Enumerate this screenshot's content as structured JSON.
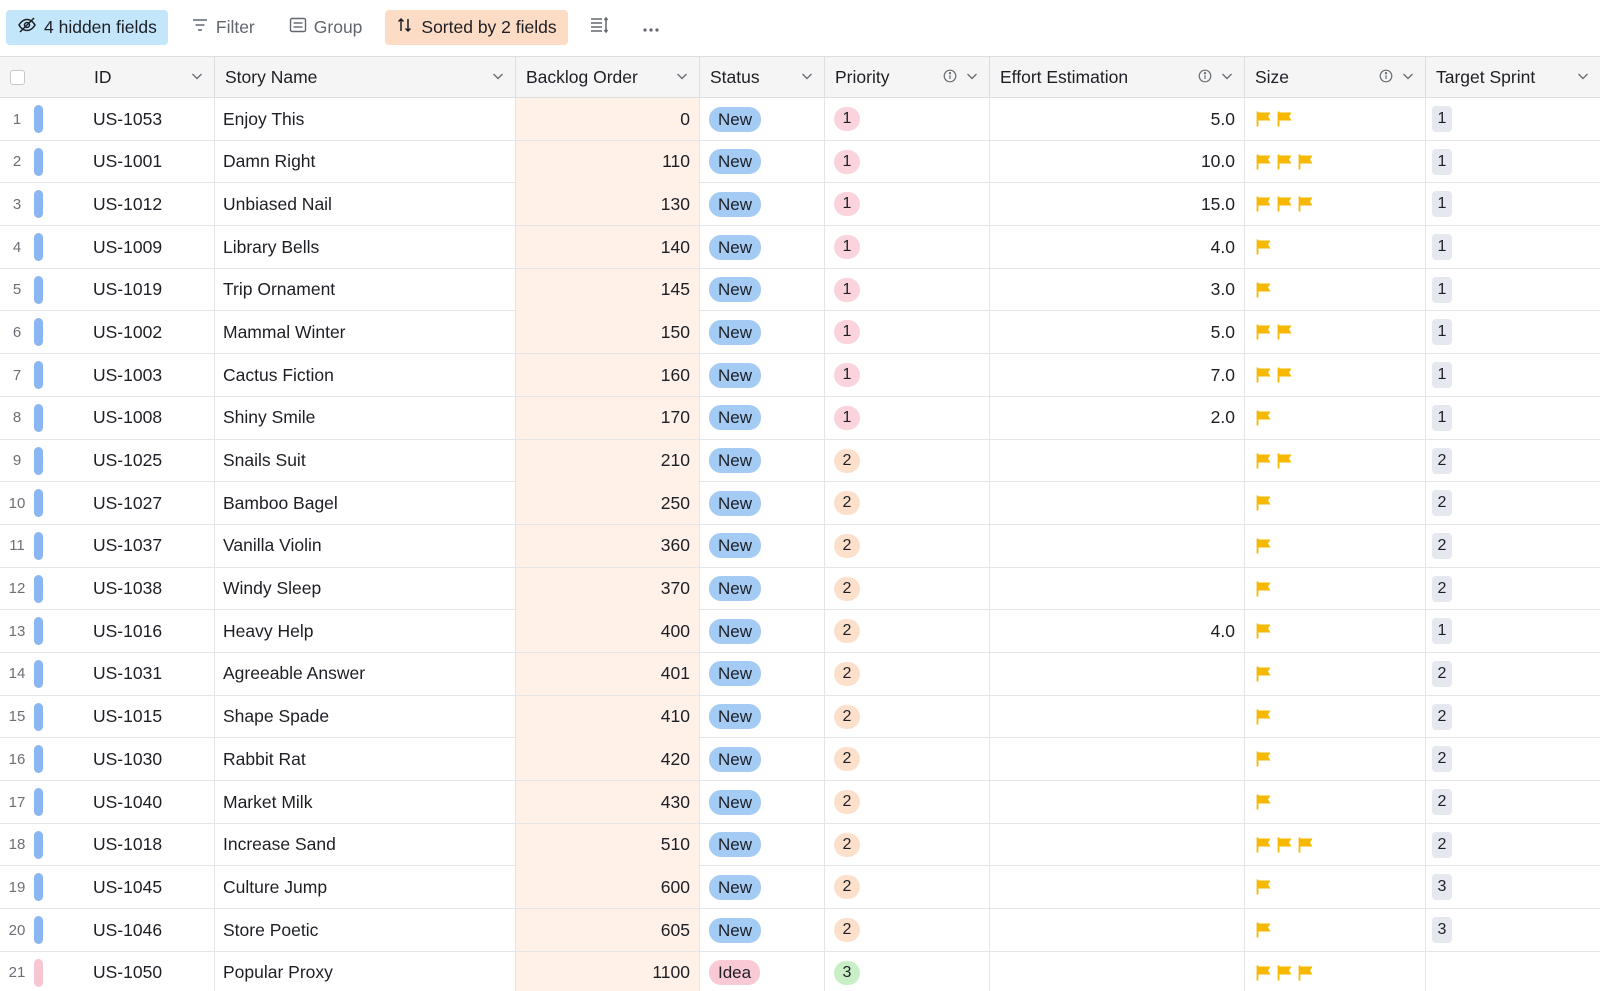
{
  "toolbar": {
    "hidden_fields_label": "4 hidden fields",
    "filter_label": "Filter",
    "group_label": "Group",
    "sorted_label": "Sorted by 2 fields"
  },
  "columns": {
    "id": "ID",
    "story_name": "Story Name",
    "backlog_order": "Backlog Order",
    "status": "Status",
    "priority": "Priority",
    "effort": "Effort Estimation",
    "size": "Size",
    "target_sprint": "Target Sprint"
  },
  "colors": {
    "flag": "#f6b800",
    "new_status": "#a4cbf4",
    "idea_status": "#f9c9d6",
    "sorted_column_bg": "#fff0e8"
  },
  "rows": [
    {
      "num": "1",
      "id": "US-1053",
      "name": "Enjoy This",
      "order": "0",
      "status": "New",
      "priority": "1",
      "effort": "5.0",
      "size": 2,
      "sprint": "1"
    },
    {
      "num": "2",
      "id": "US-1001",
      "name": "Damn Right",
      "order": "110",
      "status": "New",
      "priority": "1",
      "effort": "10.0",
      "size": 3,
      "sprint": "1"
    },
    {
      "num": "3",
      "id": "US-1012",
      "name": "Unbiased Nail",
      "order": "130",
      "status": "New",
      "priority": "1",
      "effort": "15.0",
      "size": 3,
      "sprint": "1"
    },
    {
      "num": "4",
      "id": "US-1009",
      "name": "Library Bells",
      "order": "140",
      "status": "New",
      "priority": "1",
      "effort": "4.0",
      "size": 1,
      "sprint": "1"
    },
    {
      "num": "5",
      "id": "US-1019",
      "name": "Trip Ornament",
      "order": "145",
      "status": "New",
      "priority": "1",
      "effort": "3.0",
      "size": 1,
      "sprint": "1"
    },
    {
      "num": "6",
      "id": "US-1002",
      "name": "Mammal Winter",
      "order": "150",
      "status": "New",
      "priority": "1",
      "effort": "5.0",
      "size": 2,
      "sprint": "1"
    },
    {
      "num": "7",
      "id": "US-1003",
      "name": "Cactus Fiction",
      "order": "160",
      "status": "New",
      "priority": "1",
      "effort": "7.0",
      "size": 2,
      "sprint": "1"
    },
    {
      "num": "8",
      "id": "US-1008",
      "name": "Shiny Smile",
      "order": "170",
      "status": "New",
      "priority": "1",
      "effort": "2.0",
      "size": 1,
      "sprint": "1"
    },
    {
      "num": "9",
      "id": "US-1025",
      "name": "Snails Suit",
      "order": "210",
      "status": "New",
      "priority": "2",
      "effort": "",
      "size": 2,
      "sprint": "2"
    },
    {
      "num": "10",
      "id": "US-1027",
      "name": "Bamboo Bagel",
      "order": "250",
      "status": "New",
      "priority": "2",
      "effort": "",
      "size": 1,
      "sprint": "2"
    },
    {
      "num": "11",
      "id": "US-1037",
      "name": "Vanilla Violin",
      "order": "360",
      "status": "New",
      "priority": "2",
      "effort": "",
      "size": 1,
      "sprint": "2"
    },
    {
      "num": "12",
      "id": "US-1038",
      "name": "Windy Sleep",
      "order": "370",
      "status": "New",
      "priority": "2",
      "effort": "",
      "size": 1,
      "sprint": "2"
    },
    {
      "num": "13",
      "id": "US-1016",
      "name": "Heavy Help",
      "order": "400",
      "status": "New",
      "priority": "2",
      "effort": "4.0",
      "size": 1,
      "sprint": "1"
    },
    {
      "num": "14",
      "id": "US-1031",
      "name": "Agreeable Answer",
      "order": "401",
      "status": "New",
      "priority": "2",
      "effort": "",
      "size": 1,
      "sprint": "2"
    },
    {
      "num": "15",
      "id": "US-1015",
      "name": "Shape Spade",
      "order": "410",
      "status": "New",
      "priority": "2",
      "effort": "",
      "size": 1,
      "sprint": "2"
    },
    {
      "num": "16",
      "id": "US-1030",
      "name": "Rabbit Rat",
      "order": "420",
      "status": "New",
      "priority": "2",
      "effort": "",
      "size": 1,
      "sprint": "2"
    },
    {
      "num": "17",
      "id": "US-1040",
      "name": "Market Milk",
      "order": "430",
      "status": "New",
      "priority": "2",
      "effort": "",
      "size": 1,
      "sprint": "2"
    },
    {
      "num": "18",
      "id": "US-1018",
      "name": "Increase Sand",
      "order": "510",
      "status": "New",
      "priority": "2",
      "effort": "",
      "size": 3,
      "sprint": "2"
    },
    {
      "num": "19",
      "id": "US-1045",
      "name": "Culture Jump",
      "order": "600",
      "status": "New",
      "priority": "2",
      "effort": "",
      "size": 1,
      "sprint": "3"
    },
    {
      "num": "20",
      "id": "US-1046",
      "name": "Store Poetic",
      "order": "605",
      "status": "New",
      "priority": "2",
      "effort": "",
      "size": 1,
      "sprint": "3"
    },
    {
      "num": "21",
      "id": "US-1050",
      "name": "Popular Proxy",
      "order": "1100",
      "status": "Idea",
      "priority": "3",
      "effort": "",
      "size": 3,
      "sprint": ""
    }
  ]
}
